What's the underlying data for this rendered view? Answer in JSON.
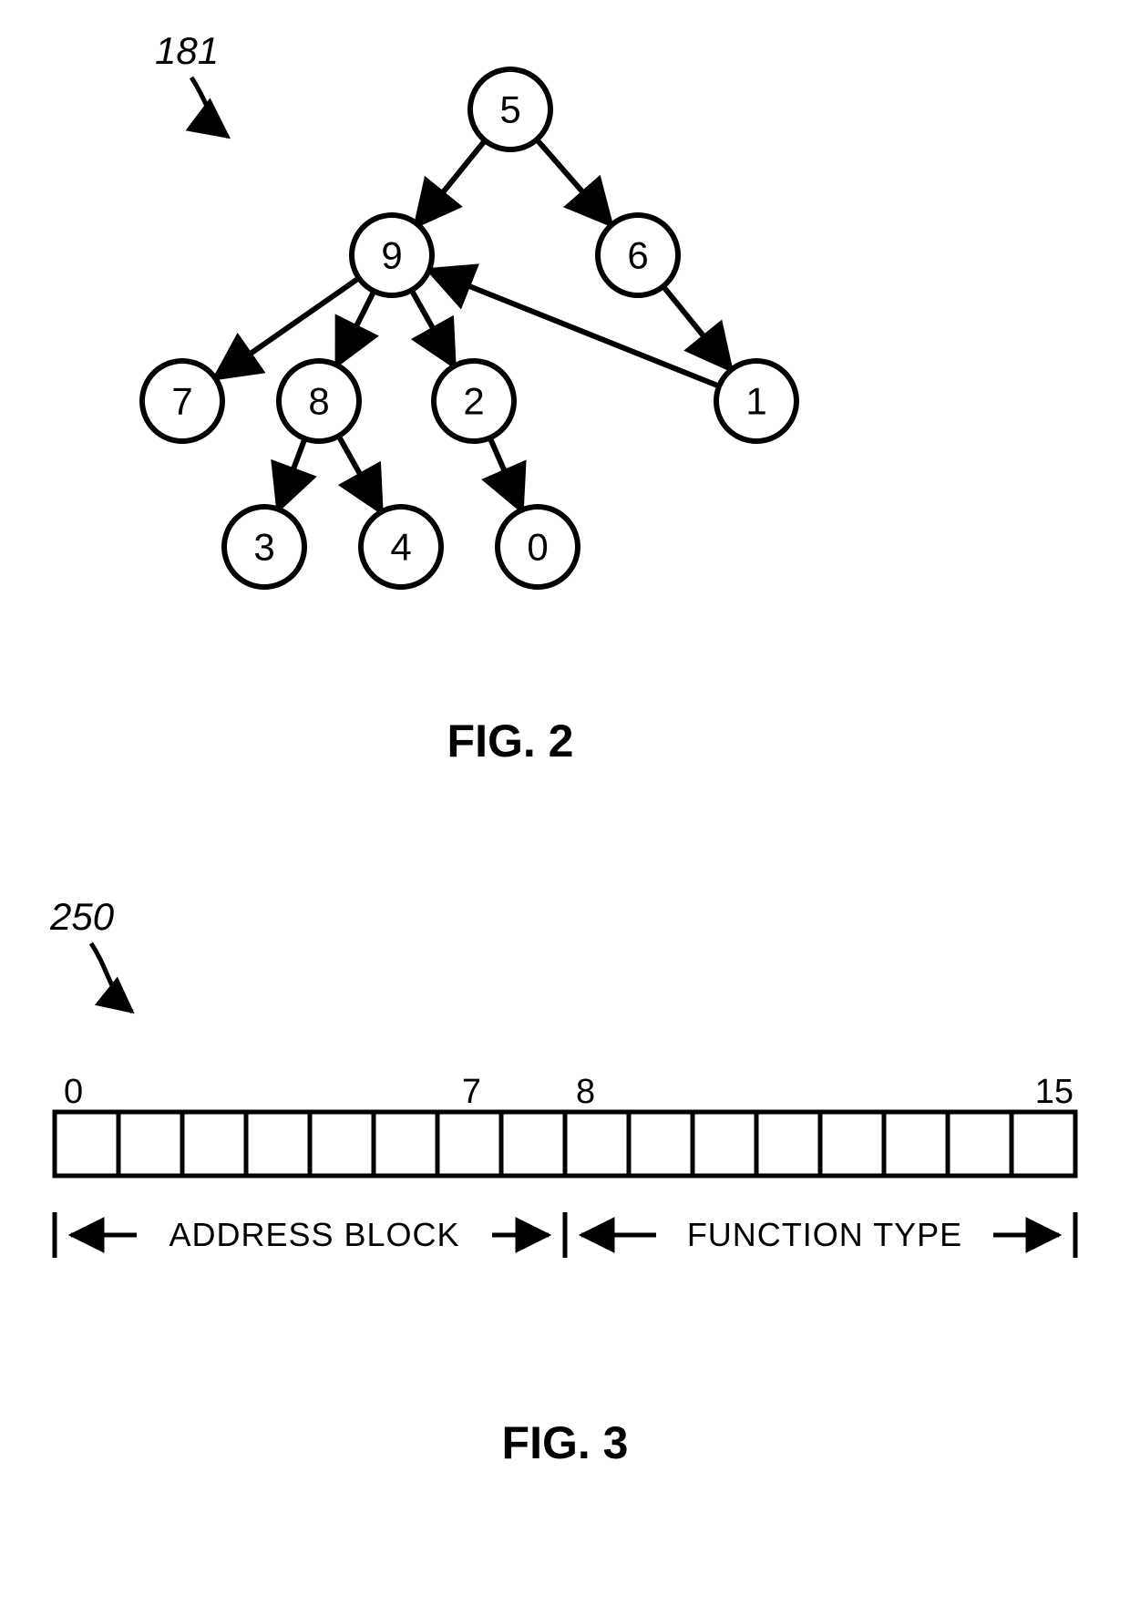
{
  "fig2": {
    "ref": "181",
    "caption": "FIG. 2",
    "nodes": {
      "n5": "5",
      "n9": "9",
      "n6": "6",
      "n7": "7",
      "n8": "8",
      "n2": "2",
      "n1": "1",
      "n3": "3",
      "n4": "4",
      "n0": "0"
    },
    "edges": [
      [
        "n5",
        "n9"
      ],
      [
        "n5",
        "n6"
      ],
      [
        "n9",
        "n7"
      ],
      [
        "n9",
        "n8"
      ],
      [
        "n9",
        "n2"
      ],
      [
        "n6",
        "n1"
      ],
      [
        "n1",
        "n9"
      ],
      [
        "n8",
        "n3"
      ],
      [
        "n8",
        "n4"
      ],
      [
        "n2",
        "n0"
      ]
    ]
  },
  "fig3": {
    "ref": "250",
    "caption": "FIG. 3",
    "bits": {
      "b0": "0",
      "b7": "7",
      "b8": "8",
      "b15": "15"
    },
    "labels": {
      "address": "ADDRESS BLOCK",
      "function": "FUNCTION TYPE"
    },
    "cell_count": 16
  }
}
